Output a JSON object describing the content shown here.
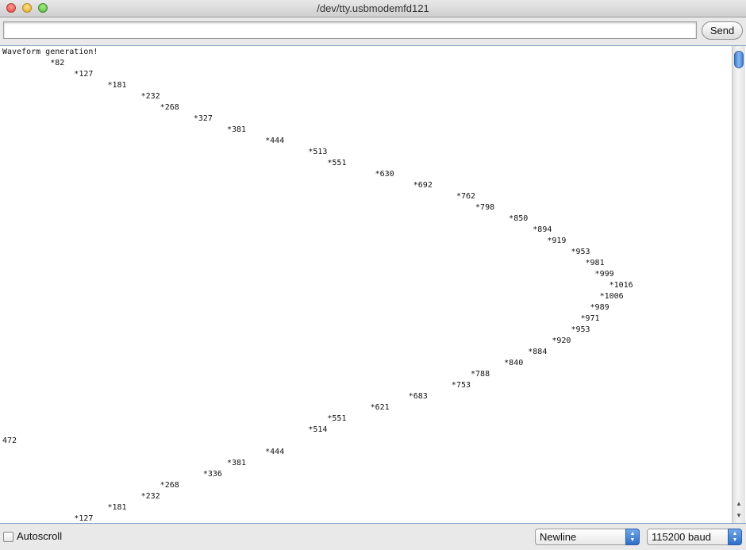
{
  "window": {
    "title": "/dev/tty.usbmodemfd121"
  },
  "send_bar": {
    "input_value": "",
    "send_label": "Send"
  },
  "console": {
    "lines": [
      "Waveform generation!",
      "          *82",
      "               *127",
      "                      *181",
      "                             *232",
      "                                 *268",
      "                                        *327",
      "                                               *381",
      "                                                       *444",
      "                                                                *513",
      "                                                                    *551",
      "                                                                              *630",
      "                                                                                      *692",
      "                                                                                               *762",
      "                                                                                                   *798",
      "                                                                                                          *850",
      "                                                                                                               *894",
      "                                                                                                                  *919",
      "                                                                                                                       *953",
      "                                                                                                                          *981",
      "                                                                                                                            *999",
      "                                                                                                                               *1016",
      "                                                                                                                             *1006",
      "                                                                                                                           *989",
      "                                                                                                                         *971",
      "                                                                                                                       *953",
      "                                                                                                                   *920",
      "                                                                                                              *884",
      "                                                                                                         *840",
      "                                                                                                  *788",
      "                                                                                              *753",
      "                                                                                     *683",
      "                                                                             *621",
      "                                                                    *551",
      "                                                                *514",
      "472",
      "                                                       *444",
      "                                               *381",
      "                                          *336",
      "                                 *268",
      "                             *232",
      "                      *181",
      "               *127"
    ]
  },
  "bottom_bar": {
    "autoscroll_label": "Autoscroll",
    "autoscroll_checked": false,
    "line_ending_selected": "Newline",
    "baud_selected": "115200 baud"
  },
  "colors": {
    "accent_blue": "#3d7fd1",
    "close_red": "#e0443e",
    "minimize_yellow": "#e0a92a",
    "zoom_green": "#52b83a"
  },
  "icons": [
    "close-light",
    "minimize-light",
    "zoom-light",
    "scroll-up-arrow",
    "scroll-down-arrow",
    "select-updown-arrows"
  ]
}
